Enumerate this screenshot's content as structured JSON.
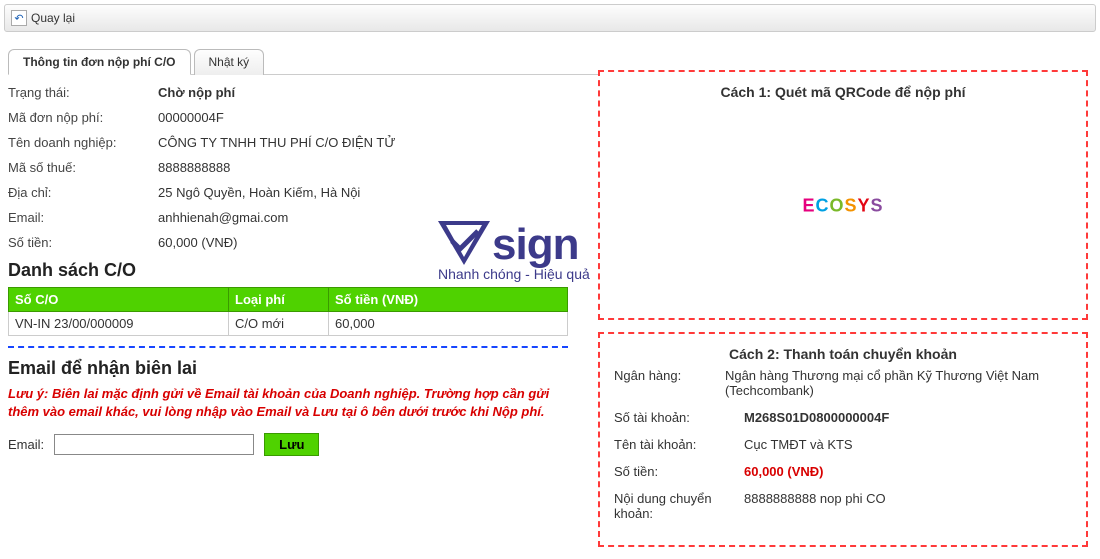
{
  "toolbar": {
    "back_label": "Quay lại"
  },
  "tabs": {
    "info_label": "Thông tin đơn nộp phí C/O",
    "log_label": "Nhật ký"
  },
  "info": {
    "status_label": "Trạng thái:",
    "status_value": "Chờ nộp phí",
    "orderid_label": "Mã đơn nộp phí:",
    "orderid_value": "00000004F",
    "company_label": "Tên doanh nghiệp:",
    "company_value": "CÔNG TY TNHH THU PHÍ C/O ĐIỆN TỬ",
    "tax_label": "Mã số thuế:",
    "tax_value": "8888888888",
    "address_label": "Địa chỉ:",
    "address_value": "25 Ngô Quyền, Hoàn Kiếm, Hà Nội",
    "email_label": "Email:",
    "email_value": "anhhienah@gmai.com",
    "amount_label": "Số tiền:",
    "amount_value": "60,000 (VNĐ)"
  },
  "co_list": {
    "title": "Danh sách C/O",
    "headers": {
      "no": "Số C/O",
      "type": "Loại phí",
      "amount": "Số tiền (VNĐ)"
    },
    "rows": [
      {
        "no": "VN-IN 23/00/000009",
        "type": "C/O mới",
        "amount": "60,000"
      }
    ]
  },
  "receipt": {
    "title": "Email để nhận biên lai",
    "warning": "Lưu ý: Biên lai mặc định gửi về Email tài khoản của Doanh nghiệp. Trường hợp cần gửi thêm vào email khác, vui lòng nhập vào Email và Lưu tại ô bên dưới trước khi Nộp phí.",
    "email_label": "Email:",
    "email_value": "",
    "save_label": "Lưu"
  },
  "payment": {
    "method1_title": "Cách 1: Quét mã QRCode để nộp phí",
    "qr_brand": {
      "e": "E",
      "c": "C",
      "o": "O",
      "s": "S",
      "y": "Y",
      "s2": "S"
    },
    "method2_title": "Cách 2: Thanh toán chuyển khoản",
    "bank_label": "Ngân hàng:",
    "bank_value": "Ngân hàng Thương mại cổ phần Kỹ Thương Việt Nam (Techcombank)",
    "acct_label": "Số tài khoản:",
    "acct_value": "M268S01D0800000004F",
    "acctname_label": "Tên tài khoản:",
    "acctname_value": "Cục TMĐT và KTS",
    "amount_label": "Số tiền:",
    "amount_value": "60,000 (VNĐ)",
    "content_label": "Nội dung chuyển khoản:",
    "content_value": "8888888888 nop phi CO"
  },
  "watermark": {
    "brand": "sign",
    "tagline": "Nhanh chóng - Hiệu quả"
  }
}
